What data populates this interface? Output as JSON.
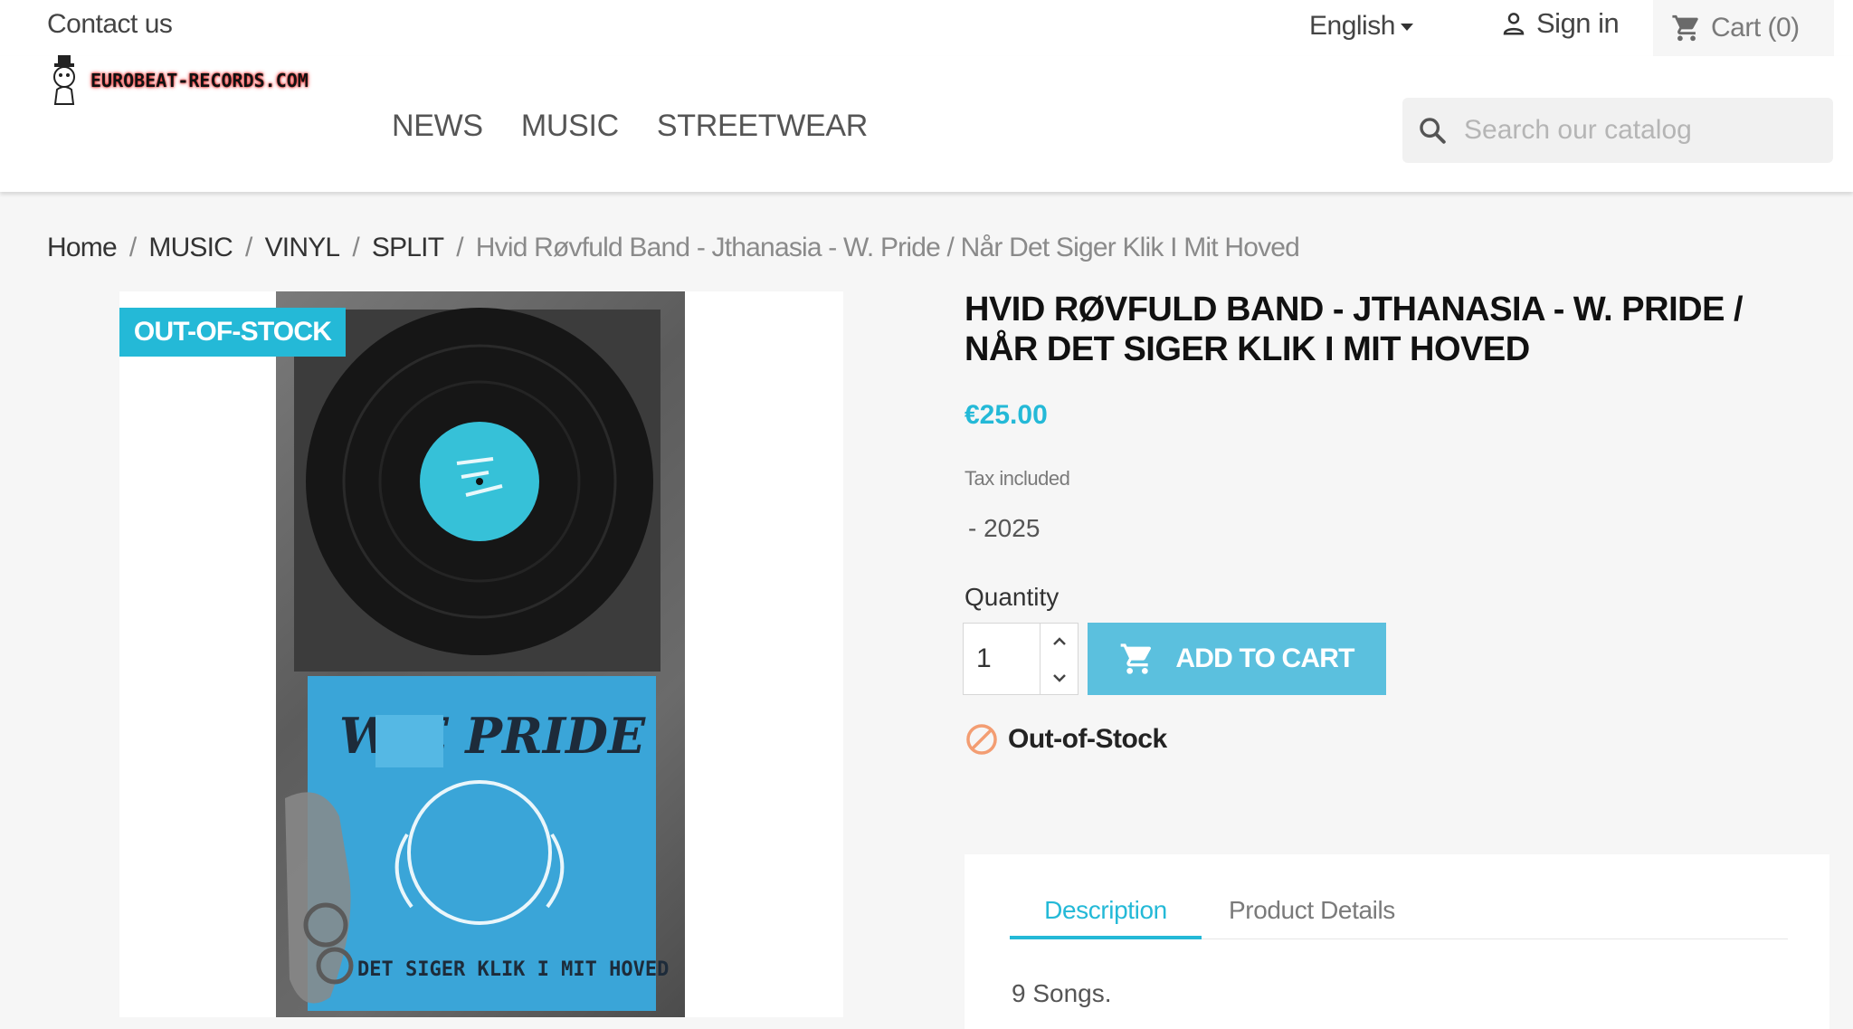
{
  "topbar": {
    "contact": "Contact us",
    "language": "English",
    "signin": "Sign in",
    "cart": "Cart (0)"
  },
  "header": {
    "logo_text": "EUROBEAT-RECORDS.COM",
    "nav": [
      "NEWS",
      "MUSIC",
      "STREETWEAR"
    ],
    "search_placeholder": "Search our catalog"
  },
  "breadcrumb": {
    "items": [
      "Home",
      "MUSIC",
      "VINYL",
      "SPLIT"
    ],
    "current": "Hvid Røvfuld Band - Jthanasia - W. Pride / Når Det Siger Klik I Mit Hoved"
  },
  "product": {
    "flag": "OUT-OF-STOCK",
    "title": "HVID RØVFULD BAND - JTHANASIA - W. PRIDE / NÅR DET SIGER KLIK I MIT HOVED",
    "price": "€25.00",
    "tax": "Tax included",
    "year": "- 2025",
    "quantity_label": "Quantity",
    "quantity_value": "1",
    "add_to_cart": "ADD TO CART",
    "availability": "Out-of-Stock",
    "cover_text_top": "W    E PRIDE",
    "cover_text_bottom": "DET SIGER KLIK I MIT HOVED"
  },
  "tabs": {
    "items": [
      "Description",
      "Product Details"
    ],
    "active": "Description",
    "description": "9 Songs."
  },
  "colors": {
    "accent": "#24b9d7",
    "button": "#5bc0de",
    "out_of_stock_icon": "#f39d72"
  }
}
